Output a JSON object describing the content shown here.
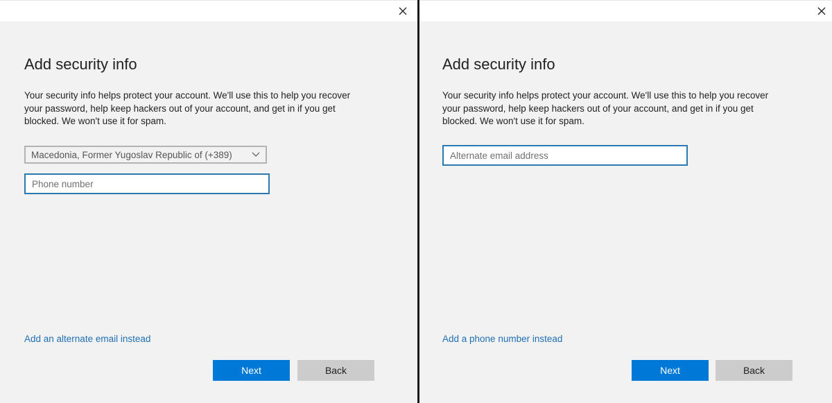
{
  "left_dialog": {
    "title": "Add security info",
    "description": "Your security info helps protect your account. We'll use this to help you recover your password, help keep hackers out of your account, and get in if you get blocked. We won't use it for spam.",
    "country_select": {
      "selected": "Macedonia, Former Yugoslav Republic of (+389)"
    },
    "phone_input": {
      "value": "",
      "placeholder": "Phone number"
    },
    "alt_link": "Add an alternate email instead",
    "next_label": "Next",
    "back_label": "Back"
  },
  "right_dialog": {
    "title": "Add security info",
    "description": "Your security info helps protect your account. We'll use this to help you recover your password, help keep hackers out of your account, and get in if you get blocked. We won't use it for spam.",
    "email_input": {
      "value": "",
      "placeholder": "Alternate email address"
    },
    "alt_link": "Add a phone number instead",
    "next_label": "Next",
    "back_label": "Back"
  },
  "icons": {
    "close": "close-icon",
    "dropdown": "chevron-down-icon"
  },
  "colors": {
    "accent": "#0078d7",
    "link": "#1f6fb5",
    "input_border": "#2a7ab0",
    "background": "#f2f2f2",
    "secondary_button": "#cccccc"
  }
}
